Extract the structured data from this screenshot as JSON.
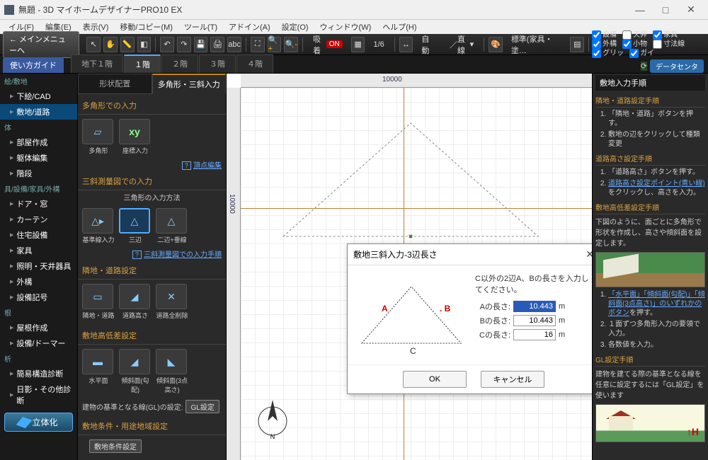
{
  "window": {
    "title": "無題 - 3D マイホームデザイナーPRO10 EX"
  },
  "menubar": [
    "イル(F)",
    "編集(E)",
    "表示(V)",
    "移動/コピー(M)",
    "ツール(T)",
    "アドイン(A)",
    "設定(O)",
    "ウィンドウ(W)",
    "ヘルプ(H)"
  ],
  "toolbar": {
    "mainmenu": "← メインメニューへ",
    "snap": {
      "label": "吸着",
      "state": "ON"
    },
    "grid_ratio": "1/6",
    "auto": "自動",
    "linemode": "直線",
    "style": "標準(家具・塗…",
    "checks": [
      {
        "label": "設備",
        "checked": true
      },
      {
        "label": "天井",
        "checked": false
      },
      {
        "label": "家具",
        "checked": true
      },
      {
        "label": "外構",
        "checked": true
      },
      {
        "label": "小物",
        "checked": true
      },
      {
        "label": "寸法線",
        "checked": false
      },
      {
        "label": "グリッ",
        "checked": true
      },
      {
        "label": "ガイ",
        "checked": true
      }
    ]
  },
  "tabs": {
    "guide": "使い方ガイド",
    "floors": [
      "地下１階",
      "１階",
      "２階",
      "３階",
      "４階"
    ],
    "active": "１階",
    "datacenter": "データセンタ"
  },
  "leftnav": {
    "groups": [
      {
        "cat": "絵/敷地",
        "items": [
          "下絵/CAD",
          "敷地/道路"
        ],
        "sel": "敷地/道路"
      },
      {
        "cat": "体",
        "items": [
          "部屋作成",
          "躯体編集",
          "階段"
        ]
      },
      {
        "cat": "具/設備/家具/外構",
        "items": [
          "ドア・窓",
          "カーテン",
          "住宅設備",
          "家具",
          "照明・天井器具",
          "外構",
          "設備記号"
        ]
      },
      {
        "cat": "根",
        "items": [
          "屋根作成",
          "設備/ドーマー"
        ]
      },
      {
        "cat": "析",
        "items": [
          "簡易構造診断",
          "日影・その他診断"
        ]
      }
    ],
    "solidify": "立体化"
  },
  "toolpanel": {
    "tabs": [
      "形状配置",
      "多角形・三斜入力"
    ],
    "active": "多角形・三斜入力",
    "sec1": {
      "title": "多角形での入力",
      "tiles": [
        "多角形",
        "座標入力"
      ],
      "hint": "頂点編集"
    },
    "sec2": {
      "title": "三斜測量図での入力",
      "sub": "三角形の入力方法",
      "tiles": [
        "基準線入力",
        "三辺",
        "二辺+垂線"
      ],
      "sel": "三辺",
      "hint": "三斜測量図での入力手順"
    },
    "sec3": {
      "title": "隣地・道路設定",
      "tiles": [
        "隣地・道路",
        "道路高さ",
        "道路全削除"
      ]
    },
    "sec4": {
      "title": "敷地高低差設定",
      "tiles": [
        "水平面",
        "傾斜面(勾配)",
        "傾斜面(3点高さ)"
      ],
      "note": "建物の基準となる線(GL)の設定:",
      "btn": "GL設定"
    },
    "sec5": {
      "title": "敷地条件・用途地域設定",
      "btn": "敷地条件設定"
    }
  },
  "canvas": {
    "ruler_top": "10000",
    "ruler_left": "10000"
  },
  "dialog": {
    "title": "敷地三斜入力-3辺長さ",
    "instr": "C以外の2辺A、Bの長さを入力してください。",
    "rows": [
      {
        "label": "Aの長さ:",
        "value": "10.443",
        "unit": "m",
        "selected": true
      },
      {
        "label": "Bの長さ:",
        "value": "10.443",
        "unit": "m",
        "selected": false
      },
      {
        "label": "Cの長さ:",
        "value": "16",
        "unit": "m",
        "selected": false
      }
    ],
    "tri_labels": {
      "a": "A",
      "b": "B",
      "c": "C"
    },
    "ok": "OK",
    "cancel": "キャンセル"
  },
  "right": {
    "header": "敷地入力手順",
    "s1": {
      "title": "隣地・道路設定手順",
      "items": [
        "「隣地・道路」ボタンを押す。",
        "敷地の辺をクリックして種類変更"
      ]
    },
    "s2": {
      "title": "道路高さ設定手順",
      "items": [
        "「道路高さ」ボタンを押す。",
        "道路高さ設定ポイント(青い線)をクリックし、高さを入力。"
      ]
    },
    "s3": {
      "title": "敷地高低差設定手順",
      "note": "下図のように、面ごとに多角形で形状を作成し、高さや傾斜面を設定します。",
      "items": [
        "「水平面」「傾斜面(勾配)」「傾斜面(3点高さ)」のいずれかのボタンを押す。",
        "１面ずつ多角形入力の要領で入力。",
        "各数値を入力。"
      ]
    },
    "s4": {
      "title": "GL設定手順",
      "note": "建物を建てる際の基準となる線を任意に設定するには「GL設定」を使います"
    },
    "arrow_h": "↑H"
  }
}
